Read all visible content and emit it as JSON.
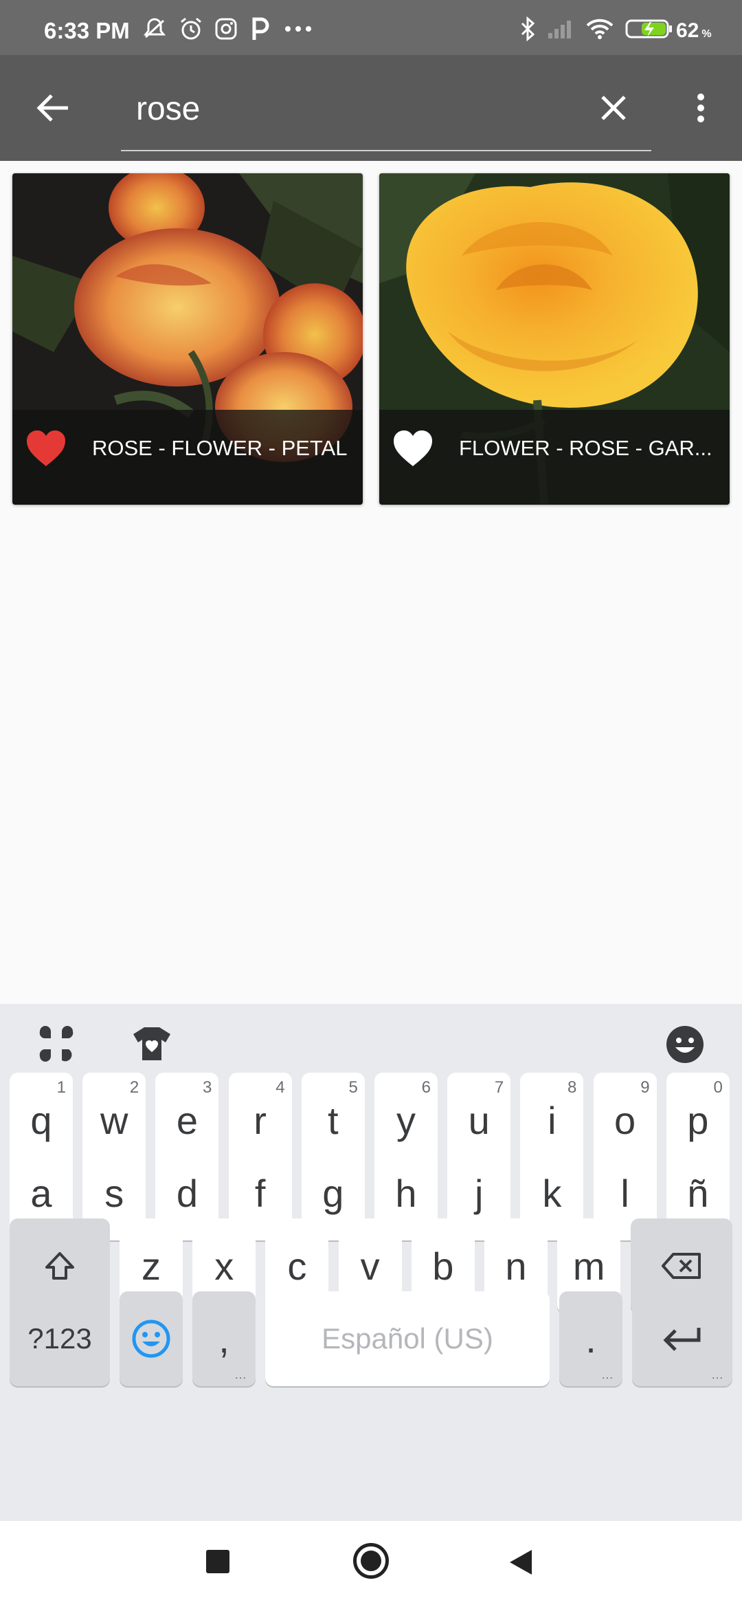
{
  "status_bar": {
    "time": "6:33 PM",
    "battery": "62",
    "battery_unit": "%",
    "icons": [
      "mute-icon",
      "alarm-icon",
      "instagram-icon",
      "parking-icon",
      "more-dots-icon",
      "bluetooth-icon",
      "signal-icon",
      "wifi-icon",
      "battery-charging-icon"
    ]
  },
  "toolbar": {
    "query": "rose",
    "back_icon": "back-arrow-icon",
    "clear_icon": "close-icon",
    "menu_icon": "more-vert-icon"
  },
  "results": [
    {
      "tags": "ROSE - FLOWER - PETAL",
      "favorited": true,
      "fav_color": "#e53935"
    },
    {
      "tags": "FLOWER - ROSE - GAR...",
      "favorited": false,
      "fav_color": "#ffffff"
    }
  ],
  "keyboard": {
    "rows": [
      [
        {
          "k": "q",
          "h": "1"
        },
        {
          "k": "w",
          "h": "2"
        },
        {
          "k": "e",
          "h": "3"
        },
        {
          "k": "r",
          "h": "4"
        },
        {
          "k": "t",
          "h": "5"
        },
        {
          "k": "y",
          "h": "6"
        },
        {
          "k": "u",
          "h": "7"
        },
        {
          "k": "i",
          "h": "8"
        },
        {
          "k": "o",
          "h": "9"
        },
        {
          "k": "p",
          "h": "0"
        }
      ],
      [
        {
          "k": "a"
        },
        {
          "k": "s"
        },
        {
          "k": "d"
        },
        {
          "k": "f"
        },
        {
          "k": "g"
        },
        {
          "k": "h"
        },
        {
          "k": "j"
        },
        {
          "k": "k"
        },
        {
          "k": "l"
        },
        {
          "k": "ñ"
        }
      ],
      [
        {
          "k": "z"
        },
        {
          "k": "x"
        },
        {
          "k": "c"
        },
        {
          "k": "v"
        },
        {
          "k": "b"
        },
        {
          "k": "n"
        },
        {
          "k": "m"
        }
      ]
    ],
    "symbols_label": "?123",
    "comma_label": ",",
    "space_label": "Español (US)",
    "period_label": ".",
    "accent_color": "#2196f3"
  }
}
